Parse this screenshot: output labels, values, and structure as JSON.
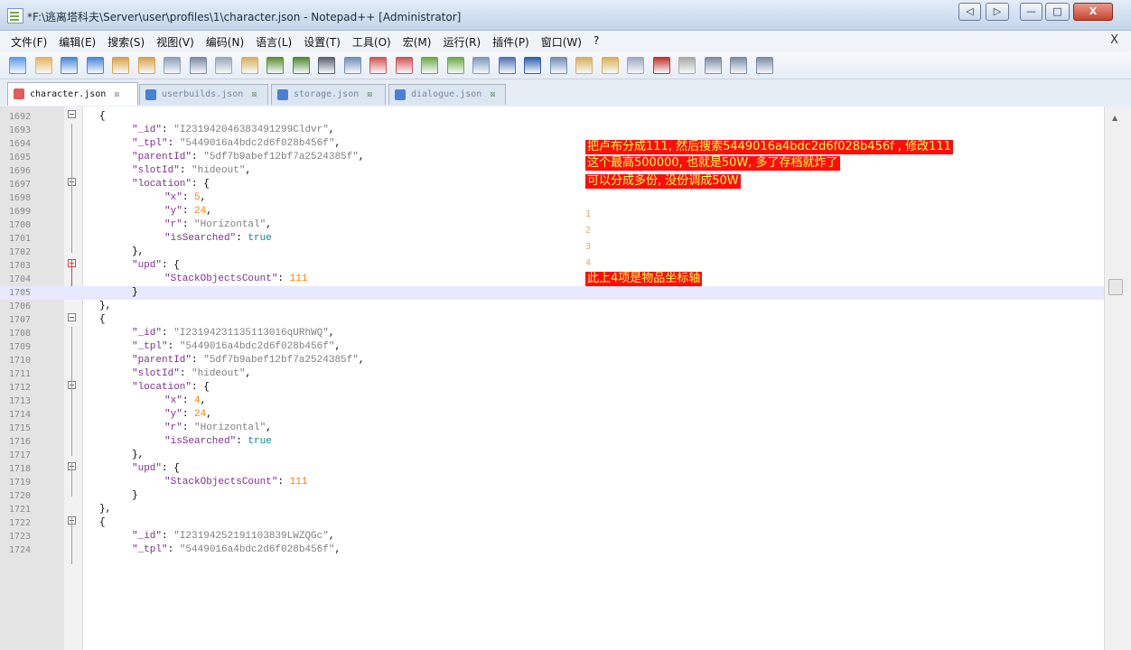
{
  "window": {
    "title": "*F:\\逃离塔科夫\\Server\\user\\profiles\\1\\character.json - Notepad++ [Administrator]",
    "controls": {
      "back": "◁",
      "forward": "▷",
      "minimize": "—",
      "maximize": "□",
      "close": "X"
    }
  },
  "menu": {
    "items": [
      "文件(F)",
      "编辑(E)",
      "搜索(S)",
      "视图(V)",
      "编码(N)",
      "语言(L)",
      "设置(T)",
      "工具(O)",
      "宏(M)",
      "运行(R)",
      "插件(P)",
      "窗口(W)",
      "?"
    ],
    "close": "X"
  },
  "toolbar": {
    "icons": [
      "new-file",
      "open-file",
      "save",
      "save-all",
      "close",
      "close-all",
      "print",
      "cut",
      "copy",
      "paste",
      "undo",
      "redo",
      "find",
      "replace",
      "zoom-in",
      "zoom-out",
      "sync-vertical",
      "sync-horizontal",
      "wrap",
      "show-all",
      "indent-guide",
      "doc-map",
      "function-list",
      "folder-workspace",
      "monitor",
      "record-macro",
      "stop-macro",
      "play-macro",
      "run-macro-multiple",
      "save-macro"
    ]
  },
  "tabs": [
    {
      "label": "character.json",
      "active": true,
      "color": "#e35b5b"
    },
    {
      "label": "userbuilds.json",
      "active": false,
      "color": "#4a7fd6"
    },
    {
      "label": "storage.json",
      "active": false,
      "color": "#4a7fd6"
    },
    {
      "label": "dialogue.json",
      "active": false,
      "color": "#4a7fd6"
    }
  ],
  "tab_close_glyph": "☒",
  "editor": {
    "lines": [
      {
        "n": "1692",
        "text": "{"
      },
      {
        "n": "1693",
        "text": "\"_id\": \"I231942046383491299Cldvr\","
      },
      {
        "n": "1694",
        "text": "\"_tpl\": \"5449016a4bdc2d6f028b456f\","
      },
      {
        "n": "1695",
        "text": "\"parentId\": \"5df7b9abef12bf7a2524385f\","
      },
      {
        "n": "1696",
        "text": "\"slotId\": \"hideout\","
      },
      {
        "n": "1697",
        "text": "\"location\": {"
      },
      {
        "n": "1698",
        "text": "\"x\": 5,"
      },
      {
        "n": "1699",
        "text": "\"y\": 24,"
      },
      {
        "n": "1700",
        "text": "\"r\": \"Horizontal\","
      },
      {
        "n": "1701",
        "text": "\"isSearched\": true"
      },
      {
        "n": "1702",
        "text": "},"
      },
      {
        "n": "1703",
        "text": "\"upd\": {"
      },
      {
        "n": "1704",
        "text": "\"StackObjectsCount\": 111"
      },
      {
        "n": "1705",
        "text": "}"
      },
      {
        "n": "1706",
        "text": "},"
      },
      {
        "n": "1707",
        "text": "{"
      },
      {
        "n": "1708",
        "text": "\"_id\": \"I23194231135113016qURhWQ\","
      },
      {
        "n": "1709",
        "text": "\"_tpl\": \"5449016a4bdc2d6f028b456f\","
      },
      {
        "n": "1710",
        "text": "\"parentId\": \"5df7b9abef12bf7a2524385f\","
      },
      {
        "n": "1711",
        "text": "\"slotId\": \"hideout\","
      },
      {
        "n": "1712",
        "text": "\"location\": {"
      },
      {
        "n": "1713",
        "text": "\"x\": 4,"
      },
      {
        "n": "1714",
        "text": "\"y\": 24,"
      },
      {
        "n": "1715",
        "text": "\"r\": \"Horizontal\","
      },
      {
        "n": "1716",
        "text": "\"isSearched\": true"
      },
      {
        "n": "1717",
        "text": "},"
      },
      {
        "n": "1718",
        "text": "\"upd\": {"
      },
      {
        "n": "1719",
        "text": "\"StackObjectsCount\": 111"
      },
      {
        "n": "1720",
        "text": "}"
      },
      {
        "n": "1721",
        "text": "},"
      },
      {
        "n": "1722",
        "text": "{"
      },
      {
        "n": "1723",
        "text": "\"_id\": \"I23194252191103839LWZQGc\","
      },
      {
        "n": "1724",
        "text": "\"_tpl\": \"5449016a4bdc2d6f028b456f\","
      }
    ],
    "current_line": "1705"
  },
  "annotations": {
    "note1_line1": "把卢布分成111, 然后搜索5449016a4bdc2d6f028b456f , 修改111",
    "note1_line2": "这个最高500000, 也就是50W, 多了存档就炸了",
    "note1_line3": "可以分成多份, 没份调成50W",
    "markers": [
      "1",
      "2",
      "3",
      "4"
    ],
    "note2": "此上4项是物品坐标轴"
  },
  "colors": {
    "annotation_bg": "#ff0d0d",
    "annotation_text": "#ffff4d",
    "current_line": "#e8e8ff"
  }
}
